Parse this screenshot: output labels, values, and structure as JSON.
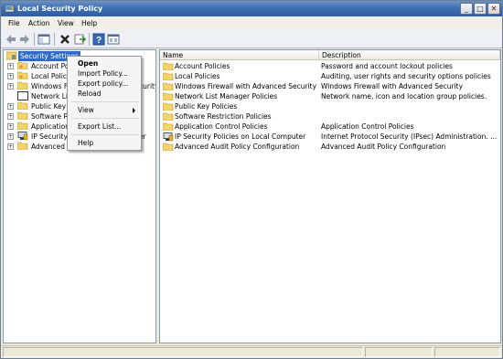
{
  "window": {
    "title": "Local Security Policy",
    "buttons": {
      "minimize": "_",
      "maximize": "□",
      "close": "✕"
    }
  },
  "menubar": {
    "items": [
      "File",
      "Action",
      "View",
      "Help"
    ]
  },
  "toolbar": {
    "icons": [
      "back-arrow-icon",
      "forward-arrow-icon",
      "show-hide-tree-icon",
      "delete-icon",
      "export-list-icon",
      "help-icon",
      "properties-icon"
    ]
  },
  "tree": {
    "root": "Security Settings",
    "items": [
      {
        "label": "Account Po"
      },
      {
        "label": "Local Policie"
      },
      {
        "label": "Windows Fi",
        "extra": "curity"
      },
      {
        "label": "Network Lis"
      },
      {
        "label": "Public Key F"
      },
      {
        "label": "Software R"
      },
      {
        "label": "Application"
      },
      {
        "label": "IP Security",
        "extra": "er"
      },
      {
        "label": "Advanced A"
      }
    ]
  },
  "context_menu": {
    "items": [
      "Open",
      "Import Policy...",
      "Export policy...",
      "Reload",
      "View",
      "Export List...",
      "Help"
    ]
  },
  "list": {
    "columns": [
      "Name",
      "Description"
    ],
    "rows": [
      {
        "name": "Account Policies",
        "description": "Password and account lockout policies"
      },
      {
        "name": "Local Policies",
        "description": "Auditing, user rights and security options policies"
      },
      {
        "name": "Windows Firewall with Advanced Security",
        "description": "Windows Firewall with Advanced Security"
      },
      {
        "name": "Network List Manager Policies",
        "description": "Network name, icon and location group policies."
      },
      {
        "name": "Public Key Policies",
        "description": ""
      },
      {
        "name": "Software Restriction Policies",
        "description": ""
      },
      {
        "name": "Application Control Policies",
        "description": "Application Control Policies"
      },
      {
        "name": "IP Security Policies on Local Computer",
        "description": "Internet Protocol Security (IPsec) Administration. ..."
      },
      {
        "name": "Advanced Audit Policy Configuration",
        "description": "Advanced Audit Policy Configuration"
      }
    ]
  },
  "colors": {
    "selection": "#316ac5",
    "titlebar": "#3d6fb3",
    "folder": "#f2d46b"
  }
}
